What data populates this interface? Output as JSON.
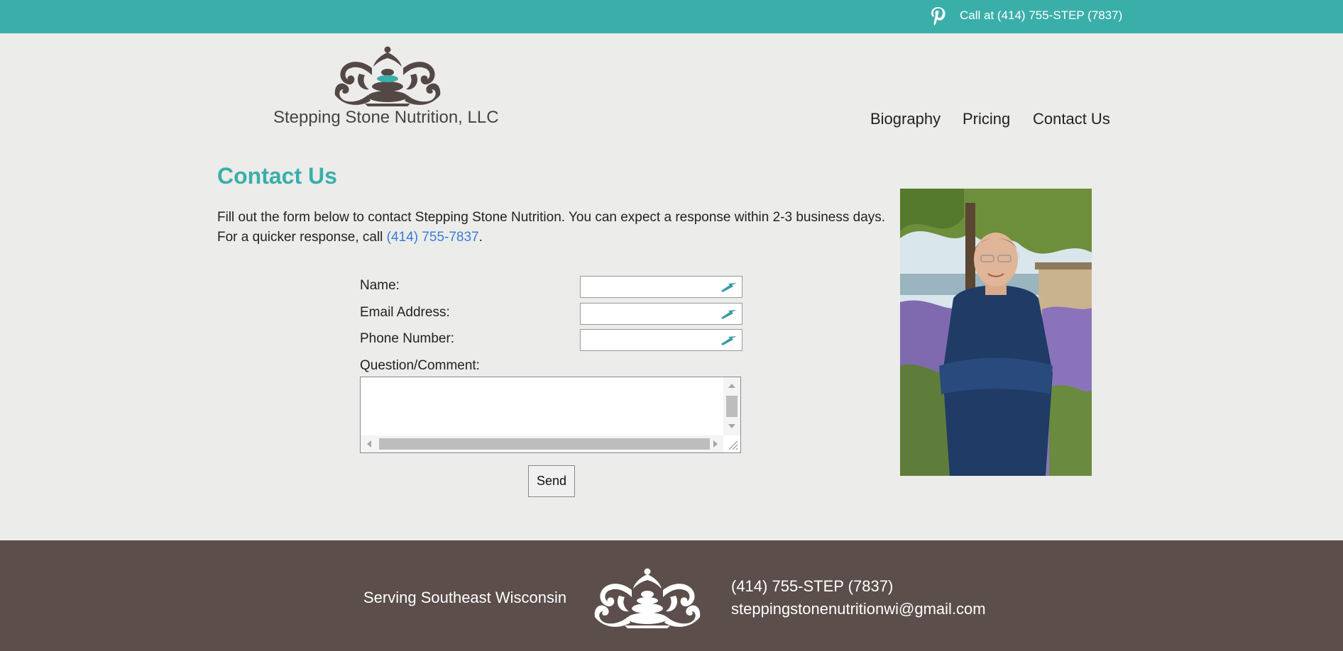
{
  "topbar": {
    "call_text": "Call at (414) 755-STEP (7837)",
    "social_icon": "pinterest-icon",
    "bg_color": "#3aafa9"
  },
  "header": {
    "brand": "Stepping Stone Nutrition, LLC",
    "nav": [
      "Biography",
      "Pricing",
      "Contact Us"
    ]
  },
  "main": {
    "heading": "Contact Us",
    "intro_text": "Fill out the form below to contact Stepping Stone Nutrition. You can expect a response within 2-3 business days. For a quicker response, call ",
    "intro_phone": "(414) 755-7837",
    "intro_end": ".",
    "accent_color": "#3aafa9",
    "link_color": "#3a7ad8"
  },
  "form": {
    "name_label": "Name:",
    "name_value": "",
    "email_label": "Email Address:",
    "email_value": "",
    "phone_label": "Phone Number:",
    "phone_value": "",
    "comment_label": "Question/Comment:",
    "comment_value": "",
    "send_label": "Send"
  },
  "footer": {
    "serving": "Serving Southeast Wisconsin",
    "phone": "(414) 755-STEP (7837)",
    "email": "steppingstonenutritionwi@gmail.com",
    "bg_color": "#5b4e4b"
  }
}
